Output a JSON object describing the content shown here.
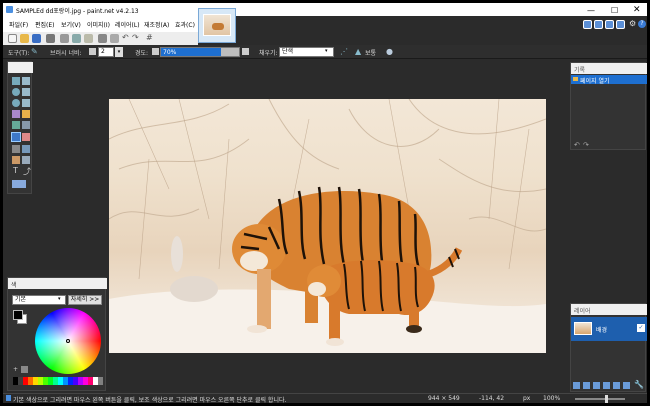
{
  "titlebar": {
    "title": "SAMPLEd dd포랑이.jpg - paint.net v4.2.13"
  },
  "menu": {
    "items": [
      "파일(F)",
      "편집(E)",
      "보기(V)",
      "이미지(I)",
      "레이어(L)",
      "재조정(A)",
      "효과(C)"
    ]
  },
  "toolbar": {
    "tool_label": "도구(T):",
    "brush_width_label": "브러시 너비:",
    "brush_width_value": "2",
    "hardness_label": "경도:",
    "hardness_value": "70%",
    "fill_label": "채우기:",
    "fill_value": "단색",
    "blend_label": "보통"
  },
  "colors": {
    "title": "색",
    "mode": "기본",
    "more_button": "자세히 >>"
  },
  "history": {
    "title": "기록",
    "items": [
      "페이지 열기"
    ]
  },
  "layers": {
    "title": "레이어",
    "items": [
      {
        "name": "배경"
      }
    ]
  },
  "status": {
    "hint": "기본 색상으로 그리려면 마우스 왼쪽 버튼을 클릭, 보조 색상으로 그리려면 마우스 오른쪽 단추로 클릭 합니다.",
    "image_size": "944 × 549",
    "cursor_pos": "-114, 42",
    "unit": "px",
    "zoom": "100%"
  },
  "icon_names": [
    "new-icon",
    "open-icon",
    "save-icon",
    "print-icon",
    "cut-icon",
    "copy-icon",
    "paste-icon",
    "crop-icon",
    "deselect-icon",
    "undo-icon",
    "redo-icon",
    "grid-icon",
    "settings-icon",
    "help-icon",
    "minimize-icon",
    "maximize-icon",
    "close-icon"
  ],
  "accent": "#1e6fd0",
  "colors_swatches": [
    "#000000",
    "#404040",
    "#ff0000",
    "#ff6a00",
    "#ffd800",
    "#b6ff00",
    "#4cff00",
    "#00ff21",
    "#00ff90",
    "#00ffff",
    "#0094ff",
    "#0026ff",
    "#4800ff",
    "#b200ff",
    "#ff00dc",
    "#ff006e",
    "#ffffff",
    "#808080"
  ]
}
